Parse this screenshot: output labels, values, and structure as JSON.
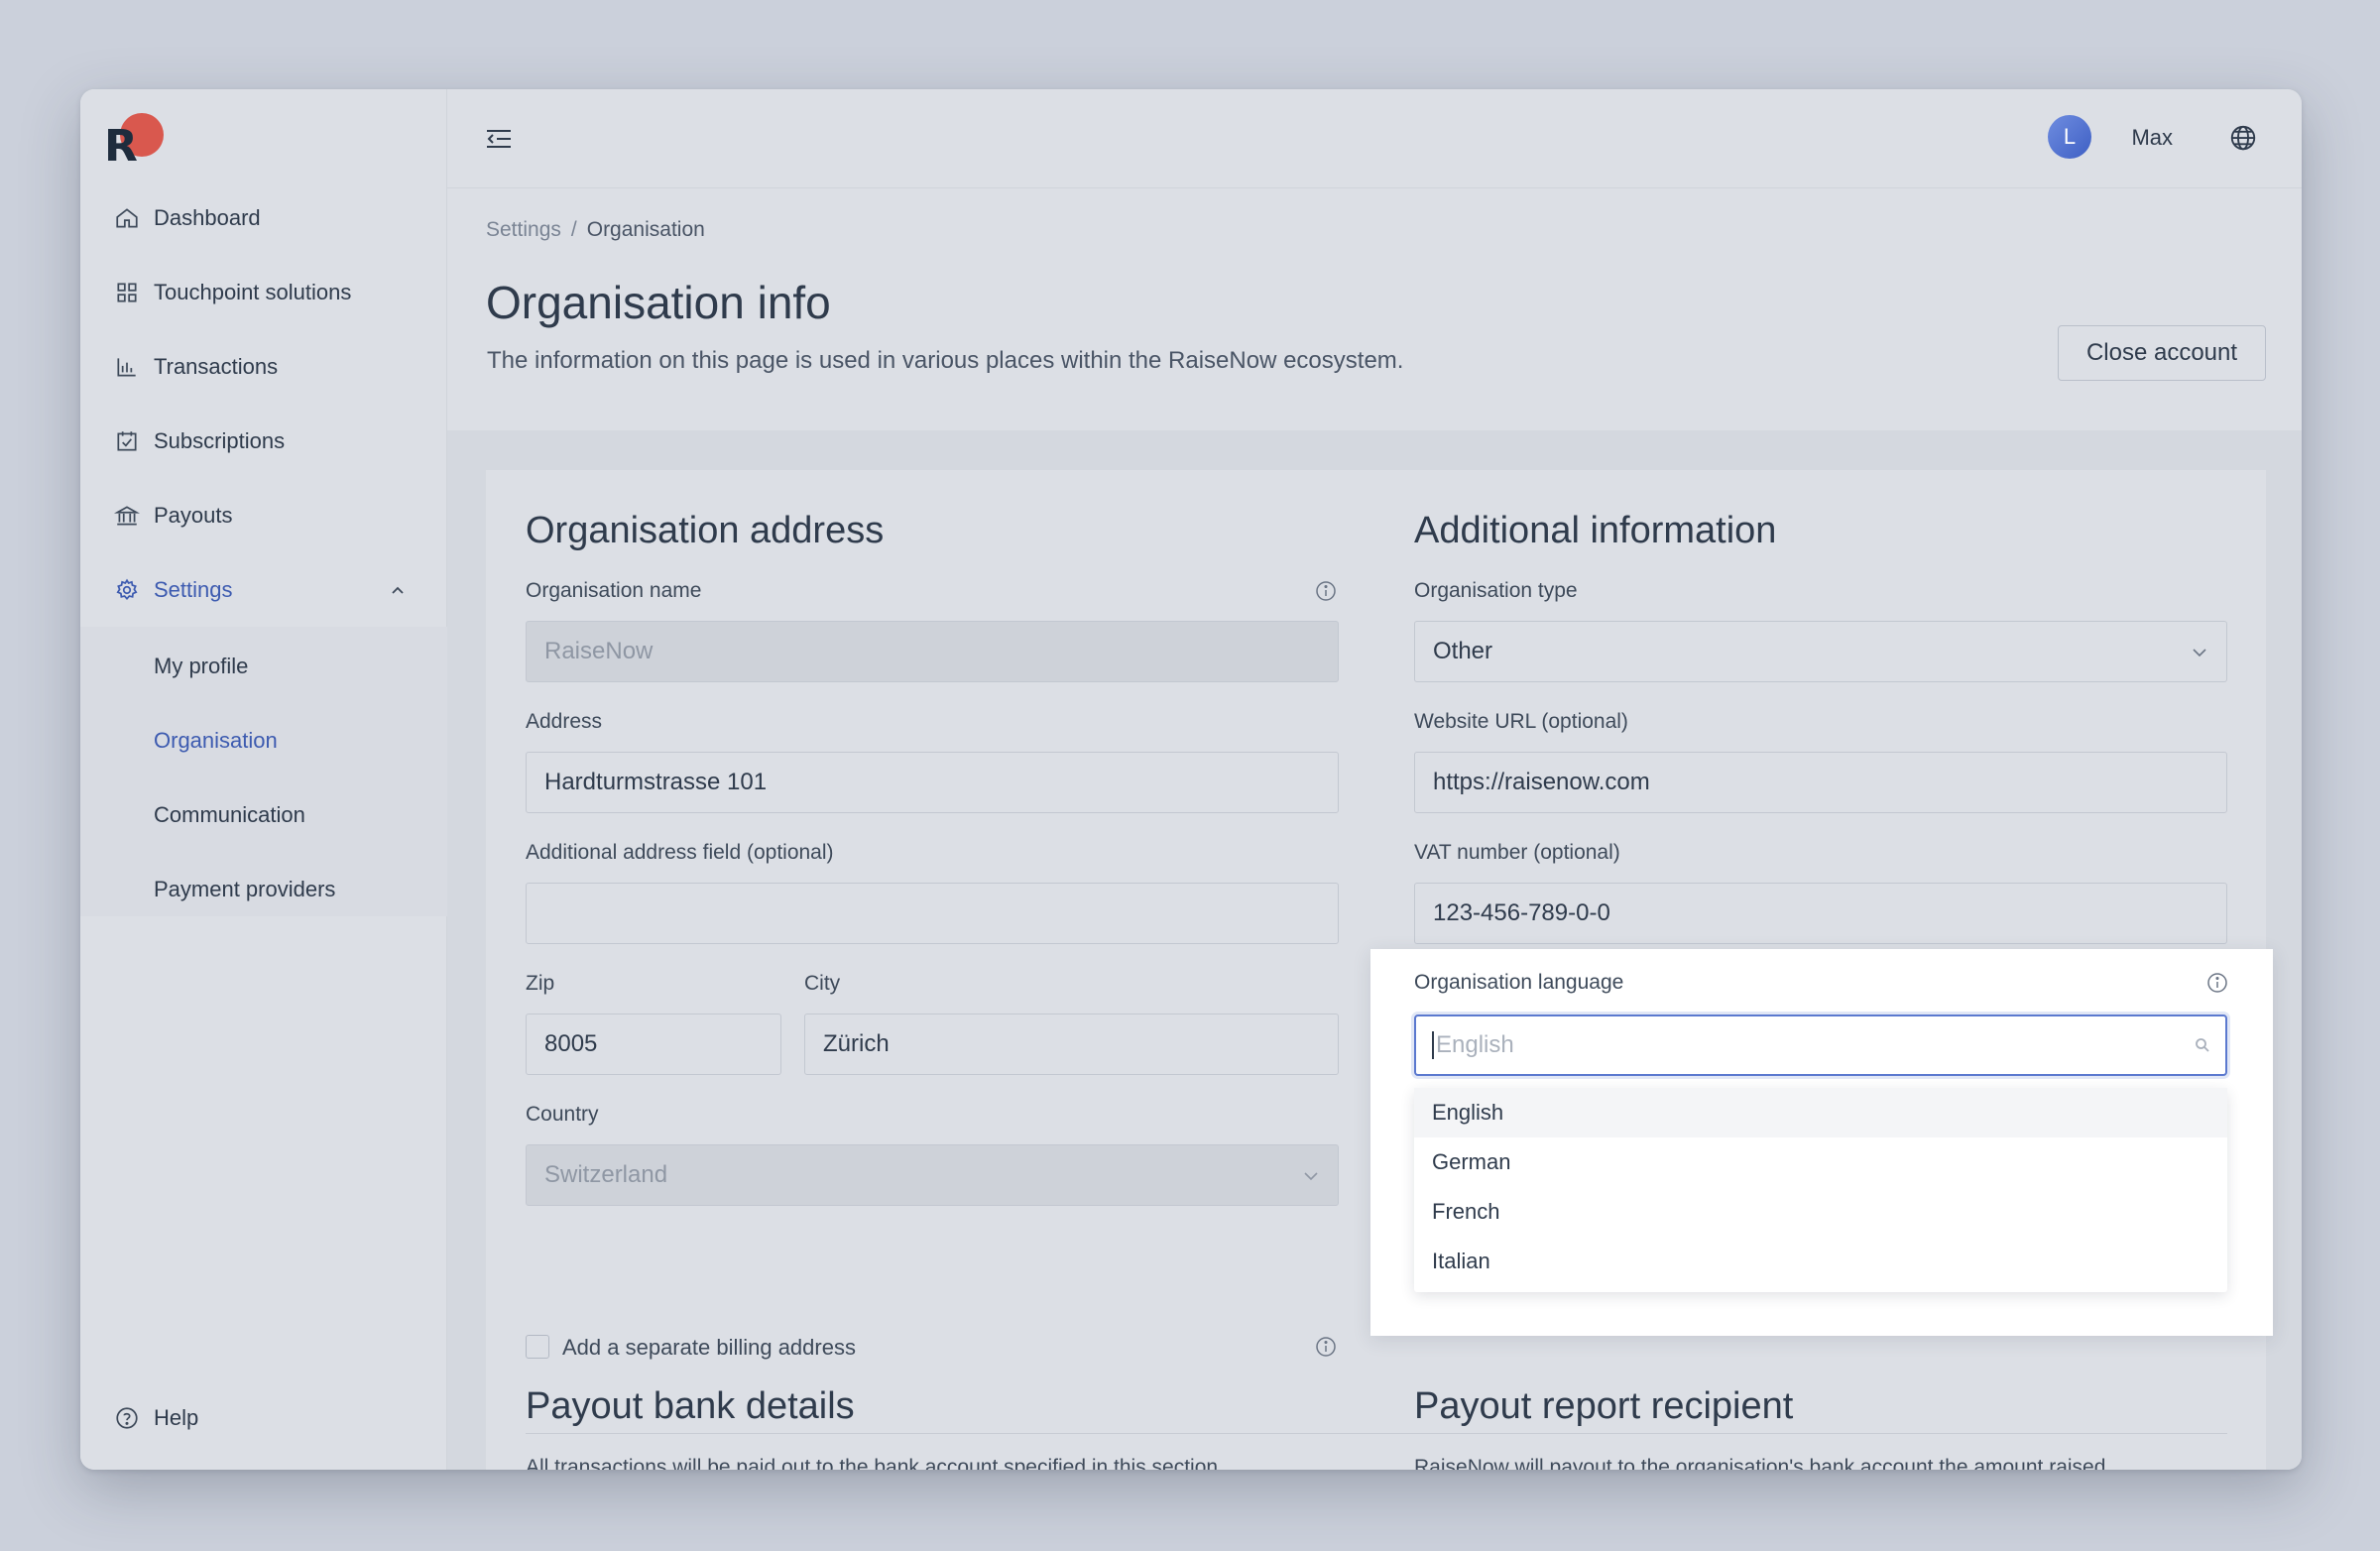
{
  "sidebar": {
    "logo_letter": "R",
    "items": [
      {
        "label": "Dashboard",
        "icon": "home-icon"
      },
      {
        "label": "Touchpoint solutions",
        "icon": "grid-icon"
      },
      {
        "label": "Transactions",
        "icon": "bar-chart-icon"
      },
      {
        "label": "Subscriptions",
        "icon": "calendar-check-icon"
      },
      {
        "label": "Payouts",
        "icon": "bank-icon"
      },
      {
        "label": "Settings",
        "icon": "gear-icon"
      }
    ],
    "settings_sub": [
      "My profile",
      "Organisation",
      "Communication",
      "Payment providers"
    ],
    "help": "Help"
  },
  "topbar": {
    "avatar_initial": "L",
    "username": "Max"
  },
  "breadcrumb": {
    "parent": "Settings",
    "separator": "/",
    "current": "Organisation"
  },
  "header": {
    "title": "Organisation info",
    "subtitle": "The information on this page is used in various places within the RaiseNow ecosystem.",
    "close_account": "Close account"
  },
  "address": {
    "title": "Organisation address",
    "org_name_label": "Organisation name",
    "org_name_value": "RaiseNow",
    "address_label": "Address",
    "address_value": "Hardturmstrasse 101",
    "additional_label": "Additional address field (optional)",
    "additional_value": "",
    "zip_label": "Zip",
    "zip_value": "8005",
    "city_label": "City",
    "city_value": "Zürich",
    "country_label": "Country",
    "country_value": "Switzerland",
    "billing_label": "Add a separate billing address"
  },
  "additional": {
    "title": "Additional information",
    "type_label": "Organisation type",
    "type_value": "Other",
    "website_label": "Website URL (optional)",
    "website_value": "https://raisenow.com",
    "vat_label": "VAT number (optional)",
    "vat_value": "123-456-789-0-0",
    "language_label": "Organisation language",
    "language_placeholder": "English",
    "language_options": [
      "English",
      "German",
      "French",
      "Italian"
    ]
  },
  "payout": {
    "bank_title": "Payout bank details",
    "bank_desc": "All transactions will be paid out to the bank account specified in this section.",
    "recipient_title": "Payout report recipient",
    "recipient_desc": "RaiseNow will payout to the organisation's bank account the amount raised"
  },
  "colors": {
    "accent": "#3d5bb0",
    "focus": "#5b79cf",
    "logo_dot": "#d9584e"
  }
}
